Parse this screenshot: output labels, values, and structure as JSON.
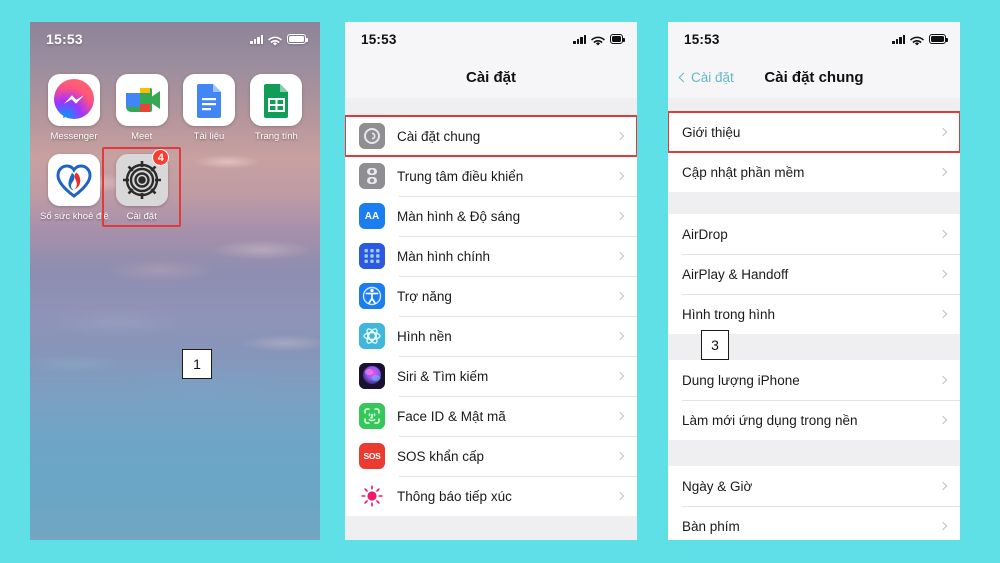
{
  "background_color": "#5ee0e6",
  "accent_highlight_color": "#e03a3a",
  "phone1": {
    "status": {
      "time": "15:53"
    },
    "apps": [
      {
        "label": "Messenger",
        "icon": "messenger-icon",
        "badge": null,
        "highlight": false
      },
      {
        "label": "Meet",
        "icon": "google-meet-icon",
        "badge": null,
        "highlight": false
      },
      {
        "label": "Tài liệu",
        "icon": "google-docs-icon",
        "badge": null,
        "highlight": false
      },
      {
        "label": "Trang tính",
        "icon": "google-sheets-icon",
        "badge": null,
        "highlight": false
      },
      {
        "label": "Sổ sức khoẻ điện tử",
        "icon": "health-heart-icon",
        "badge": null,
        "highlight": false
      },
      {
        "label": "Cài đặt",
        "icon": "settings-gear-icon",
        "badge": "4",
        "highlight": true
      }
    ],
    "step_marker": "1"
  },
  "phone2": {
    "status": {
      "time": "15:53"
    },
    "navbar": {
      "title": "Cài đặt"
    },
    "items": [
      {
        "label": "Cài đặt chung",
        "icon": "general-settings-icon",
        "color": "#8e8e93",
        "highlight": true
      },
      {
        "label": "Trung tâm điều khiển",
        "icon": "control-center-icon",
        "color": "#8e8e93",
        "highlight": false
      },
      {
        "label": "Màn hình & Độ sáng",
        "icon": "display-brightness-icon",
        "color": "#1b7ef0",
        "highlight": false
      },
      {
        "label": "Màn hình chính",
        "icon": "home-screen-icon",
        "color": "#2b59e0",
        "highlight": false
      },
      {
        "label": "Trợ năng",
        "icon": "accessibility-icon",
        "color": "#1b7ef0",
        "highlight": false
      },
      {
        "label": "Hình nền",
        "icon": "wallpaper-icon",
        "color": "#3fb6dc",
        "highlight": false
      },
      {
        "label": "Siri & Tìm kiếm",
        "icon": "siri-icon",
        "color": "#2a2140",
        "highlight": false
      },
      {
        "label": "Face ID & Mật mã",
        "icon": "face-id-icon",
        "color": "#34c759",
        "highlight": false
      },
      {
        "label": "SOS khẩn cấp",
        "icon": "sos-icon",
        "color": "#eb3b30",
        "highlight": false
      },
      {
        "label": "Thông báo tiếp xúc",
        "icon": "exposure-notification-icon",
        "color": "#ffffff",
        "highlight": false
      }
    ]
  },
  "phone3": {
    "status": {
      "time": "15:53"
    },
    "navbar": {
      "back_label": "Cài đặt",
      "title": "Cài đặt chung"
    },
    "groups": [
      {
        "items": [
          {
            "label": "Giới thiệu",
            "highlight": true
          },
          {
            "label": "Cập nhật phần mềm",
            "highlight": false
          }
        ]
      },
      {
        "items": [
          {
            "label": "AirDrop",
            "highlight": false
          },
          {
            "label": "AirPlay & Handoff",
            "highlight": false
          },
          {
            "label": "Hình trong hình",
            "highlight": false
          }
        ]
      },
      {
        "items": [
          {
            "label": "Dung lượng iPhone",
            "highlight": false
          },
          {
            "label": "Làm mới ứng dụng trong nền",
            "highlight": false
          }
        ]
      },
      {
        "items": [
          {
            "label": "Ngày & Giờ",
            "highlight": false
          },
          {
            "label": "Bàn phím",
            "highlight": false
          }
        ]
      }
    ],
    "step_marker": "3"
  }
}
